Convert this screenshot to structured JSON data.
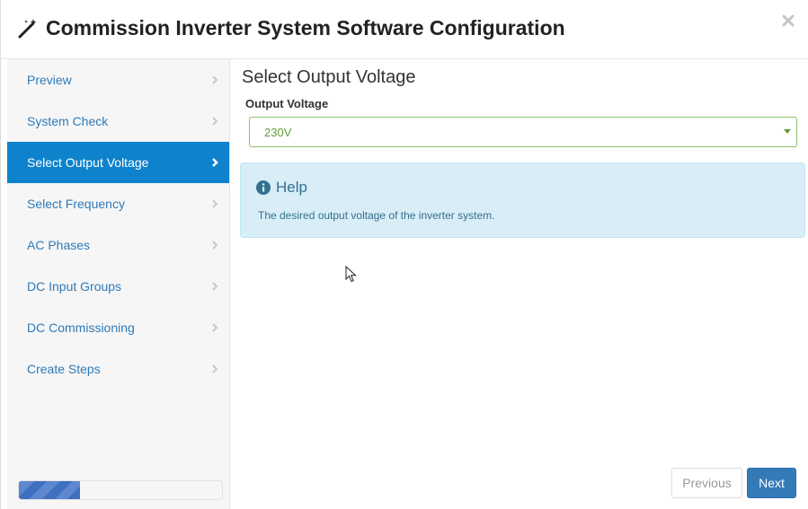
{
  "header": {
    "title": "Commission Inverter System Software Configuration",
    "title_icon": "magic-wand-icon",
    "close_icon": "close-icon"
  },
  "sidebar": {
    "items": [
      {
        "label": "Preview",
        "active": false
      },
      {
        "label": "System Check",
        "active": false
      },
      {
        "label": "Select Output Voltage",
        "active": true
      },
      {
        "label": "Select Frequency",
        "active": false
      },
      {
        "label": "AC Phases",
        "active": false
      },
      {
        "label": "DC Input Groups",
        "active": false
      },
      {
        "label": "DC Commissioning",
        "active": false
      },
      {
        "label": "Create Steps",
        "active": false
      }
    ],
    "progress_fraction": 0.3
  },
  "main": {
    "section_title": "Select Output Voltage",
    "field_label": "Output Voltage",
    "selected_value": "230V",
    "help": {
      "title": "Help",
      "icon": "info-circle-icon",
      "text": "The desired output voltage of the inverter system."
    }
  },
  "footer": {
    "previous_label": "Previous",
    "next_label": "Next"
  },
  "colors": {
    "accent": "#0e82cc",
    "link": "#2f7ab8",
    "help_bg": "#d9edf7",
    "help_text": "#31708f",
    "select_border": "#8dc26f",
    "select_text": "#5e9f3a",
    "next_button": "#337ab7"
  }
}
